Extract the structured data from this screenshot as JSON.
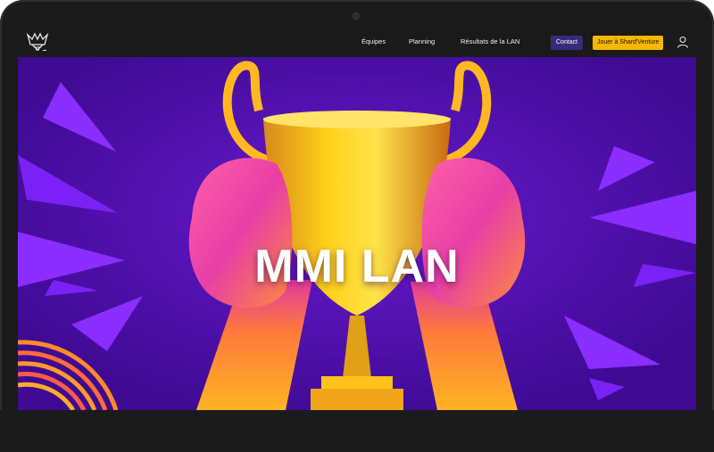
{
  "nav": {
    "items": [
      {
        "label": "Équipes"
      },
      {
        "label": "Planning"
      },
      {
        "label": "Résultats de la LAN"
      }
    ],
    "contact_label": "Contact",
    "play_label": "Jouer à Shard'Venture",
    "user_icon": "user-icon",
    "logo_icon": "trophy-crown-logo"
  },
  "hero": {
    "title": "MMI LAN",
    "image": "hands-holding-trophy"
  },
  "colors": {
    "hero_bg": "#4c0fa8",
    "accent_purple": "#7a2cff",
    "accent_yellow": "#f6b800",
    "contact_bg": "#3a2a7a",
    "nav_bg": "#1a1a1a"
  }
}
